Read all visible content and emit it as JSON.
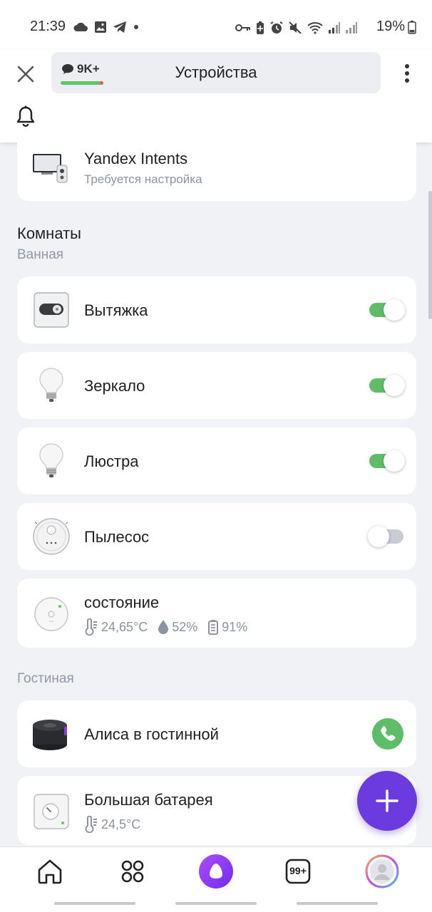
{
  "status_bar": {
    "time": "21:39",
    "battery": "19%",
    "left_icons": [
      "cloud-icon",
      "image-icon",
      "telegram-icon",
      "dot-icon"
    ],
    "right_icons": [
      "key-icon",
      "battery-saver-icon",
      "alarm-icon",
      "mute-icon",
      "wifi-icon",
      "signal-icon",
      "signal-icon"
    ]
  },
  "header": {
    "badge": "9K+",
    "title": "Устройства"
  },
  "devices_top": {
    "name": "Yandex Intents",
    "subtitle": "Требуется настройка"
  },
  "rooms": {
    "title": "Комнаты",
    "bathroom": {
      "label": "Ванная",
      "devices": [
        {
          "name": "Вытяжка",
          "icon": "switch-icon",
          "on": true
        },
        {
          "name": "Зеркало",
          "icon": "bulb-icon",
          "on": true
        },
        {
          "name": "Люстра",
          "icon": "bulb-icon",
          "on": true
        },
        {
          "name": "Пылесос",
          "icon": "vacuum-icon",
          "on": false
        }
      ],
      "sensor": {
        "name": "состояние",
        "temperature": "24,65°C",
        "humidity": "52%",
        "battery": "91%"
      }
    },
    "living": {
      "label": "Гостиная",
      "speaker": {
        "name": "Алиса в гостинной"
      },
      "heater": {
        "name": "Большая батарея",
        "temperature": "24,5°C"
      }
    }
  },
  "bottom_nav": {
    "items": [
      "home-icon",
      "grid-icon",
      "alice-icon",
      "badge-99-icon",
      "profile-icon"
    ],
    "notifications": "99+"
  },
  "colors": {
    "accent": "#6c3be0",
    "toggle_on": "#5fbd67",
    "toggle_off": "#c9ccd4",
    "background": "#f1f2f5"
  }
}
